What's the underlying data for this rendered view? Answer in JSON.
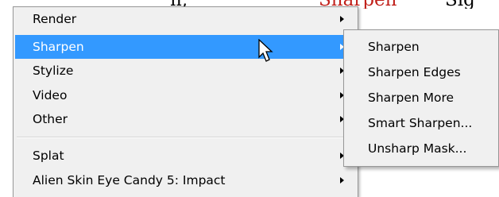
{
  "background": {
    "text_left": "n,",
    "text_highlight": "Sharpen",
    "text_right": "Sig"
  },
  "menu": {
    "items": [
      {
        "label": "Render",
        "has_submenu": true
      },
      {
        "label": "Sharpen",
        "has_submenu": true,
        "selected": true
      },
      {
        "label": "Stylize",
        "has_submenu": true
      },
      {
        "label": "Video",
        "has_submenu": true
      },
      {
        "label": "Other",
        "has_submenu": true
      },
      {
        "label": "Splat",
        "has_submenu": true
      },
      {
        "label": "Alien Skin Eye Candy 5: Impact",
        "has_submenu": true
      }
    ]
  },
  "submenu": {
    "items": [
      {
        "label": "Sharpen"
      },
      {
        "label": "Sharpen Edges"
      },
      {
        "label": "Sharpen More"
      },
      {
        "label": "Smart Sharpen..."
      },
      {
        "label": "Unsharp Mask..."
      }
    ]
  },
  "colors": {
    "menu_background": "#f0f0f0",
    "selection": "#3399ff",
    "border": "#979797"
  },
  "icons": {
    "cursor": "arrow-pointer-icon",
    "submenu_indicator": "triangle-right-icon"
  }
}
